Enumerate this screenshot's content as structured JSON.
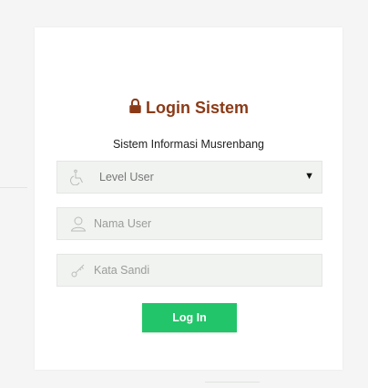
{
  "login": {
    "title": "Login Sistem",
    "subtitle": "Sistem Informasi Musrenbang",
    "level_select": {
      "value": "Level User",
      "icon": "wheelchair-icon"
    },
    "username": {
      "placeholder": "Nama User",
      "icon": "user-icon"
    },
    "password": {
      "placeholder": "Kata Sandi",
      "icon": "key-icon"
    },
    "submit_label": "Log In"
  },
  "colors": {
    "title": "#8b3a17",
    "button": "#22c56a",
    "background": "#f4f5f4"
  }
}
